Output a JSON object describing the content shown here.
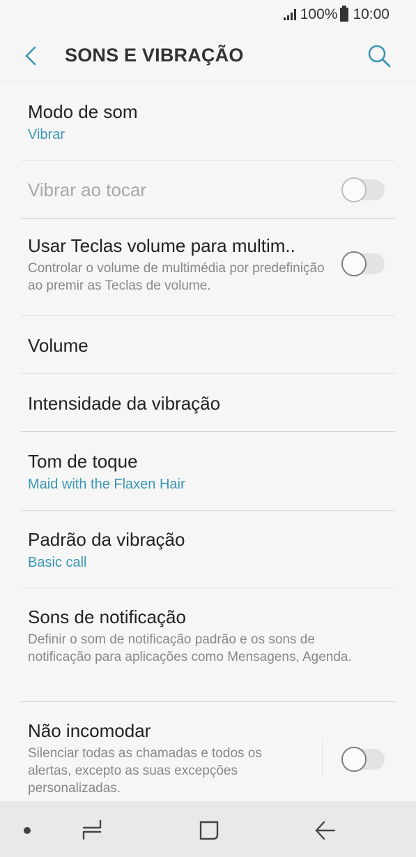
{
  "status": {
    "battery": "100%",
    "time": "10:00"
  },
  "header": {
    "title": "SONS E VIBRAÇÃO",
    "back_icon": "back-arrow-icon",
    "search_icon": "search-icon"
  },
  "items": [
    {
      "title": "Modo de som",
      "subtitle": "Vibrar"
    },
    {
      "title": "Vibrar ao tocar",
      "toggle": false,
      "disabled": true
    },
    {
      "title": "Usar Teclas volume para multim..",
      "description": "Controlar o volume de multimédia por predefinição ao premir as Teclas de volume.",
      "toggle": false
    },
    {
      "title": "Volume"
    },
    {
      "title": "Intensidade da vibração"
    },
    {
      "title": "Tom de toque",
      "subtitle": "Maid with the Flaxen Hair"
    },
    {
      "title": "Padrão da vibração",
      "subtitle": "Basic call"
    },
    {
      "title": "Sons de notificação",
      "description": "Definir o som de notificação padrão e os sons de notificação para aplicações como Mensagens, Agenda."
    },
    {
      "title": "Não incomodar",
      "description": "Silenciar todas as chamadas e todos os alertas, excepto as suas excepções personalizadas.",
      "toggle": false
    }
  ],
  "colors": {
    "accent": "#3a97b4",
    "background": "#f6f6f6",
    "navbar": "#e9e9e9"
  }
}
